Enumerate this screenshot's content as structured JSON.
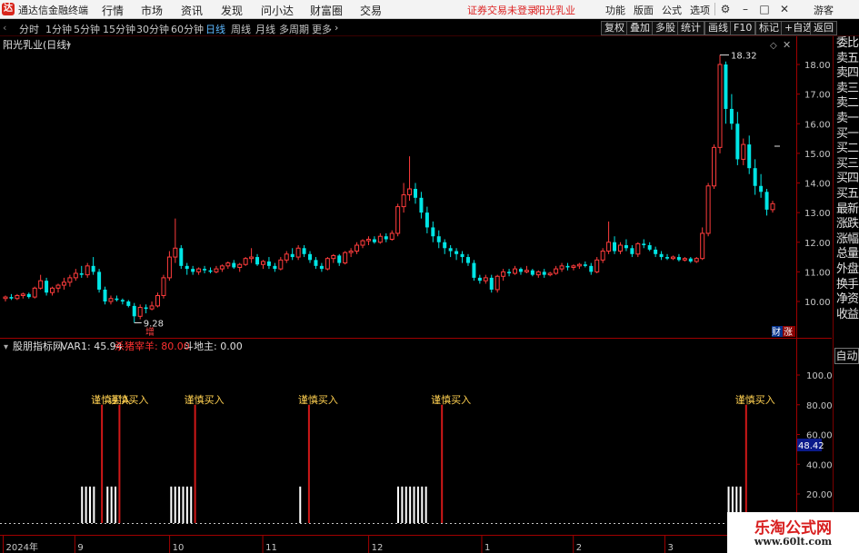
{
  "app": {
    "title": "通达信金融终端",
    "logo_text": "达"
  },
  "menu": {
    "items": [
      "行情",
      "市场",
      "资讯",
      "发现",
      "问小达",
      "财富圈",
      "交易"
    ]
  },
  "status": {
    "warning": "证券交易未登录",
    "stock": "阳光乳业"
  },
  "right_menu": {
    "items": [
      "功能",
      "版面",
      "公式",
      "选项"
    ],
    "user": "游客"
  },
  "window_icons": [
    "settings-icon",
    "minimize-icon",
    "maximize-icon",
    "close-icon"
  ],
  "periods": {
    "items": [
      "分时",
      "1分钟",
      "5分钟",
      "15分钟",
      "30分钟",
      "60分钟",
      "日线",
      "周线",
      "月线",
      "多周期",
      "更多"
    ],
    "active": "日线"
  },
  "toolbar": {
    "buttons": [
      "复权",
      "叠加",
      "多股",
      "统计",
      "画线",
      "F10",
      "标记",
      "+自选",
      "返回"
    ]
  },
  "main_chart": {
    "title": "阳光乳业(日线)",
    "high_label": "18.32",
    "low_label": "9.28",
    "event_marker": "增",
    "corner_badges": [
      "财",
      "涨"
    ],
    "price_ticks": [
      "18.00",
      "17.00",
      "16.00",
      "15.00",
      "14.00",
      "13.00",
      "12.00",
      "11.00",
      "10.00"
    ]
  },
  "indicator": {
    "name": "股朋指标网",
    "var1_label": "VAR1: 45.94",
    "line2_label": "杀猪宰羊: 80.00",
    "line3_label": "斗地主: 0.00",
    "signal_label": "谨慎买入",
    "ticks": [
      "100.00",
      "80.00",
      "60.00",
      "40.00",
      "20.00"
    ],
    "current_value": "48.42"
  },
  "time_axis": {
    "labels": [
      "2024年",
      "9",
      "10",
      "11",
      "12",
      "1",
      "2",
      "3"
    ]
  },
  "side_panel": {
    "items": [
      "委比",
      "卖五",
      "卖四",
      "卖三",
      "卖二",
      "卖一",
      "买一",
      "买二",
      "买三",
      "买四",
      "买五",
      "最新",
      "涨跌",
      "涨幅",
      "总量",
      "外盘",
      "换手",
      "净资",
      "收益"
    ],
    "auto_button": "自动"
  },
  "watermark": {
    "line1": "乐淘公式网",
    "line2": "www.60lt.com"
  },
  "colors": {
    "up": "#ff3c3c",
    "down": "#00e5e5",
    "accent": "#5db8ff",
    "axis_red": "#a00000",
    "signal_yellow": "#ffd050"
  },
  "chart_data": {
    "type": "candlestick",
    "y_range": [
      9.28,
      18.32
    ],
    "candles": [
      [
        10.1,
        10.2,
        10.0,
        10.15
      ],
      [
        10.15,
        10.25,
        10.05,
        10.1
      ],
      [
        10.1,
        10.25,
        10.05,
        10.2
      ],
      [
        10.2,
        10.3,
        10.1,
        10.25
      ],
      [
        10.25,
        10.3,
        10.1,
        10.15
      ],
      [
        10.15,
        10.5,
        10.1,
        10.45
      ],
      [
        10.45,
        10.9,
        10.4,
        10.7
      ],
      [
        10.7,
        10.8,
        10.2,
        10.3
      ],
      [
        10.3,
        10.5,
        10.2,
        10.45
      ],
      [
        10.45,
        10.6,
        10.3,
        10.55
      ],
      [
        10.55,
        10.8,
        10.4,
        10.65
      ],
      [
        10.65,
        10.9,
        10.5,
        10.8
      ],
      [
        10.8,
        11.1,
        10.7,
        10.95
      ],
      [
        10.95,
        11.2,
        10.8,
        10.9
      ],
      [
        10.9,
        11.3,
        10.8,
        11.2
      ],
      [
        11.2,
        11.5,
        10.9,
        11.0
      ],
      [
        11.0,
        11.1,
        10.3,
        10.4
      ],
      [
        10.4,
        10.5,
        9.9,
        10.0
      ],
      [
        10.0,
        10.2,
        9.9,
        10.1
      ],
      [
        10.1,
        10.2,
        10.0,
        10.05
      ],
      [
        10.05,
        10.1,
        9.9,
        10.0
      ],
      [
        10.0,
        10.05,
        9.8,
        9.85
      ],
      [
        9.85,
        9.95,
        9.28,
        9.5
      ],
      [
        9.5,
        9.9,
        9.4,
        9.8
      ],
      [
        9.8,
        9.9,
        9.6,
        9.75
      ],
      [
        9.75,
        10.0,
        9.7,
        9.85
      ],
      [
        9.85,
        10.3,
        9.8,
        10.2
      ],
      [
        10.2,
        10.9,
        10.1,
        10.8
      ],
      [
        10.8,
        11.7,
        10.7,
        11.5
      ],
      [
        11.5,
        12.8,
        11.3,
        11.8
      ],
      [
        11.8,
        11.9,
        11.1,
        11.2
      ],
      [
        11.2,
        11.3,
        10.9,
        11.1
      ],
      [
        11.1,
        11.2,
        10.9,
        11.0
      ],
      [
        11.0,
        11.15,
        10.9,
        11.1
      ],
      [
        11.1,
        11.2,
        10.95,
        11.05
      ],
      [
        11.05,
        11.15,
        10.95,
        11.0
      ],
      [
        11.0,
        11.2,
        10.95,
        11.1
      ],
      [
        11.1,
        11.25,
        11.0,
        11.2
      ],
      [
        11.2,
        11.35,
        11.1,
        11.3
      ],
      [
        11.3,
        11.4,
        11.1,
        11.15
      ],
      [
        11.15,
        11.3,
        11.0,
        11.25
      ],
      [
        11.25,
        11.5,
        11.2,
        11.45
      ],
      [
        11.45,
        11.8,
        11.3,
        11.5
      ],
      [
        11.5,
        11.6,
        11.2,
        11.25
      ],
      [
        11.25,
        11.4,
        11.1,
        11.35
      ],
      [
        11.35,
        11.5,
        11.1,
        11.2
      ],
      [
        11.2,
        11.3,
        11.0,
        11.1
      ],
      [
        11.1,
        11.5,
        11.05,
        11.4
      ],
      [
        11.4,
        11.7,
        11.3,
        11.6
      ],
      [
        11.6,
        11.8,
        11.4,
        11.5
      ],
      [
        11.5,
        11.9,
        11.4,
        11.8
      ],
      [
        11.8,
        11.9,
        11.5,
        11.6
      ],
      [
        11.6,
        11.7,
        11.3,
        11.4
      ],
      [
        11.4,
        11.5,
        11.1,
        11.2
      ],
      [
        11.2,
        11.3,
        11.0,
        11.1
      ],
      [
        11.1,
        11.5,
        11.05,
        11.45
      ],
      [
        11.45,
        11.6,
        11.3,
        11.55
      ],
      [
        11.55,
        11.6,
        11.2,
        11.3
      ],
      [
        11.3,
        11.7,
        11.25,
        11.65
      ],
      [
        11.65,
        11.8,
        11.5,
        11.7
      ],
      [
        11.7,
        12.0,
        11.6,
        11.9
      ],
      [
        11.9,
        12.1,
        11.8,
        12.05
      ],
      [
        12.05,
        12.2,
        11.9,
        12.1
      ],
      [
        12.1,
        12.2,
        11.95,
        12.0
      ],
      [
        12.0,
        12.3,
        11.95,
        12.2
      ],
      [
        12.2,
        12.3,
        12.0,
        12.1
      ],
      [
        12.1,
        12.4,
        12.05,
        12.3
      ],
      [
        12.3,
        13.3,
        12.2,
        13.2
      ],
      [
        13.2,
        14.0,
        13.0,
        13.6
      ],
      [
        13.6,
        14.9,
        13.4,
        13.8
      ],
      [
        13.8,
        14.0,
        13.3,
        13.5
      ],
      [
        13.5,
        13.7,
        12.8,
        13.0
      ],
      [
        13.0,
        13.2,
        12.3,
        12.5
      ],
      [
        12.5,
        12.7,
        12.0,
        12.2
      ],
      [
        12.2,
        12.4,
        11.8,
        12.0
      ],
      [
        12.0,
        12.1,
        11.6,
        11.8
      ],
      [
        11.8,
        11.9,
        11.5,
        11.7
      ],
      [
        11.7,
        11.8,
        11.4,
        11.6
      ],
      [
        11.6,
        11.7,
        11.3,
        11.5
      ],
      [
        11.5,
        11.6,
        11.2,
        11.3
      ],
      [
        11.3,
        11.4,
        10.7,
        10.8
      ],
      [
        10.8,
        10.9,
        10.6,
        10.7
      ],
      [
        10.7,
        10.9,
        10.6,
        10.8
      ],
      [
        10.8,
        10.9,
        10.3,
        10.4
      ],
      [
        10.4,
        10.9,
        10.3,
        10.85
      ],
      [
        10.85,
        11.1,
        10.7,
        11.0
      ],
      [
        11.0,
        11.1,
        10.85,
        10.95
      ],
      [
        10.95,
        11.2,
        10.9,
        11.1
      ],
      [
        11.1,
        11.15,
        10.9,
        11.0
      ],
      [
        11.0,
        11.2,
        10.95,
        11.05
      ],
      [
        11.05,
        11.1,
        10.85,
        10.9
      ],
      [
        10.9,
        11.05,
        10.8,
        11.0
      ],
      [
        11.0,
        11.1,
        10.8,
        10.9
      ],
      [
        10.9,
        11.0,
        10.85,
        10.95
      ],
      [
        10.95,
        11.2,
        10.9,
        11.1
      ],
      [
        11.1,
        11.3,
        11.0,
        11.2
      ],
      [
        11.2,
        11.3,
        11.05,
        11.15
      ],
      [
        11.15,
        11.25,
        11.05,
        11.2
      ],
      [
        11.2,
        11.3,
        11.1,
        11.25
      ],
      [
        11.25,
        11.35,
        11.15,
        11.2
      ],
      [
        11.2,
        11.3,
        10.9,
        11.0
      ],
      [
        11.0,
        11.5,
        10.95,
        11.4
      ],
      [
        11.4,
        11.8,
        11.3,
        11.7
      ],
      [
        11.7,
        12.7,
        11.6,
        12.0
      ],
      [
        12.0,
        12.2,
        11.6,
        11.7
      ],
      [
        11.7,
        12.0,
        11.6,
        11.9
      ],
      [
        11.9,
        12.1,
        11.7,
        11.8
      ],
      [
        11.8,
        11.9,
        11.5,
        11.6
      ],
      [
        11.6,
        12.0,
        11.5,
        11.95
      ],
      [
        11.95,
        12.1,
        11.8,
        11.9
      ],
      [
        11.9,
        12.0,
        11.7,
        11.75
      ],
      [
        11.75,
        11.85,
        11.5,
        11.6
      ],
      [
        11.6,
        11.7,
        11.4,
        11.5
      ],
      [
        11.5,
        11.6,
        11.4,
        11.45
      ],
      [
        11.45,
        11.55,
        11.4,
        11.5
      ],
      [
        11.5,
        11.6,
        11.35,
        11.4
      ],
      [
        11.4,
        11.5,
        11.35,
        11.45
      ],
      [
        11.45,
        11.5,
        11.3,
        11.35
      ],
      [
        11.35,
        11.5,
        11.3,
        11.45
      ],
      [
        11.45,
        12.5,
        11.4,
        12.3
      ],
      [
        12.3,
        14.0,
        12.2,
        13.9
      ],
      [
        13.9,
        15.3,
        13.8,
        15.2
      ],
      [
        15.2,
        18.32,
        15.0,
        18.0
      ],
      [
        18.0,
        18.1,
        16.0,
        16.5
      ],
      [
        16.5,
        17.0,
        15.8,
        16.0
      ],
      [
        16.0,
        16.4,
        14.6,
        14.8
      ],
      [
        14.8,
        15.5,
        14.6,
        15.3
      ],
      [
        15.3,
        15.6,
        14.3,
        14.5
      ],
      [
        14.5,
        14.8,
        13.6,
        13.9
      ],
      [
        13.9,
        14.3,
        13.5,
        13.7
      ],
      [
        13.7,
        13.8,
        12.9,
        13.1
      ],
      [
        13.1,
        13.4,
        13.0,
        13.3
      ]
    ],
    "signals": {
      "positions": [
        0.128,
        0.15,
        0.245,
        0.388,
        0.555,
        0.937
      ],
      "label": "谨慎买入",
      "value": 80
    },
    "bars": {
      "positions": [
        0.103,
        0.108,
        0.113,
        0.118,
        0.135,
        0.14,
        0.145,
        0.215,
        0.22,
        0.225,
        0.23,
        0.235,
        0.24,
        0.377,
        0.5,
        0.505,
        0.51,
        0.515,
        0.52,
        0.525,
        0.53,
        0.535,
        0.915,
        0.92,
        0.925,
        0.93
      ],
      "value": 25
    },
    "var1_value": 48.42
  }
}
